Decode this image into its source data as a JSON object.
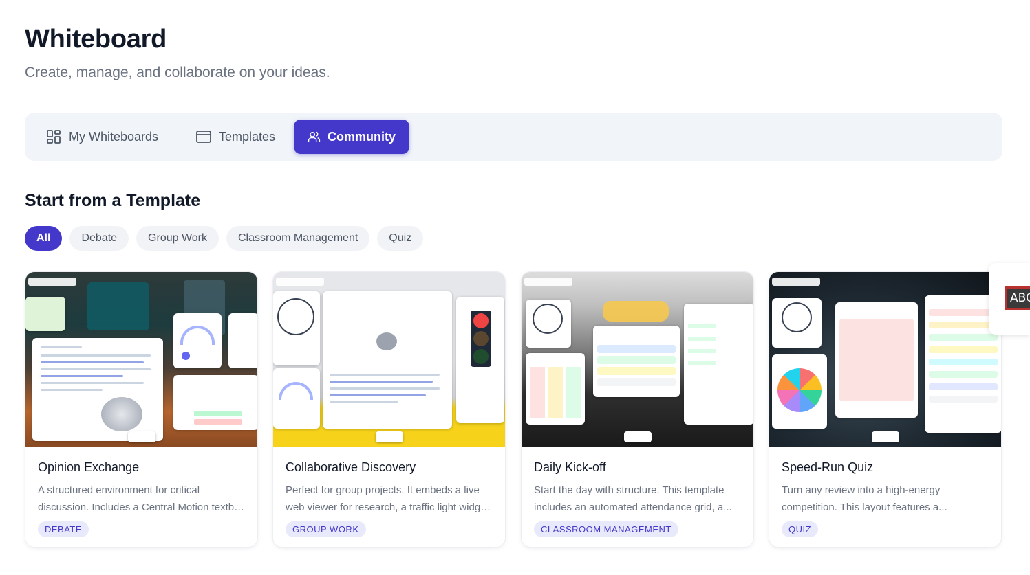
{
  "header": {
    "title": "Whiteboard",
    "subtitle": "Create, manage, and collaborate on your ideas."
  },
  "tabs": [
    {
      "label": "My Whiteboards",
      "icon": "grid-icon",
      "active": false
    },
    {
      "label": "Templates",
      "icon": "browser-window-icon",
      "active": false
    },
    {
      "label": "Community",
      "icon": "users-icon",
      "active": true
    }
  ],
  "section": {
    "title": "Start from a Template"
  },
  "filters": [
    {
      "label": "All",
      "active": true
    },
    {
      "label": "Debate",
      "active": false
    },
    {
      "label": "Group Work",
      "active": false
    },
    {
      "label": "Classroom Management",
      "active": false
    },
    {
      "label": "Quiz",
      "active": false
    }
  ],
  "cards": [
    {
      "title": "Opinion Exchange",
      "desc_line1": "A structured environment for critical",
      "desc_line2": "discussion. Includes a Central Motion textbo...",
      "tag": "DEBATE"
    },
    {
      "title": "Collaborative Discovery",
      "desc_line1": "Perfect for group projects. It embeds a live",
      "desc_line2": "web viewer for research, a traffic light widge...",
      "tag": "GROUP WORK"
    },
    {
      "title": "Daily Kick-off",
      "desc_line1": "Start the day with structure. This template",
      "desc_line2": "includes an automated attendance grid, a...",
      "tag": "CLASSROOM MANAGEMENT"
    },
    {
      "title": "Speed-Run Quiz",
      "desc_line1": "Turn any review into a high-energy",
      "desc_line2": "competition. This layout features a...",
      "tag": "QUIZ"
    }
  ],
  "side_peek": {
    "text": "ABC"
  },
  "colors": {
    "accent": "#4338ca",
    "tag_bg": "#e8e9fb",
    "tab_bar_bg": "#f1f4f9"
  }
}
